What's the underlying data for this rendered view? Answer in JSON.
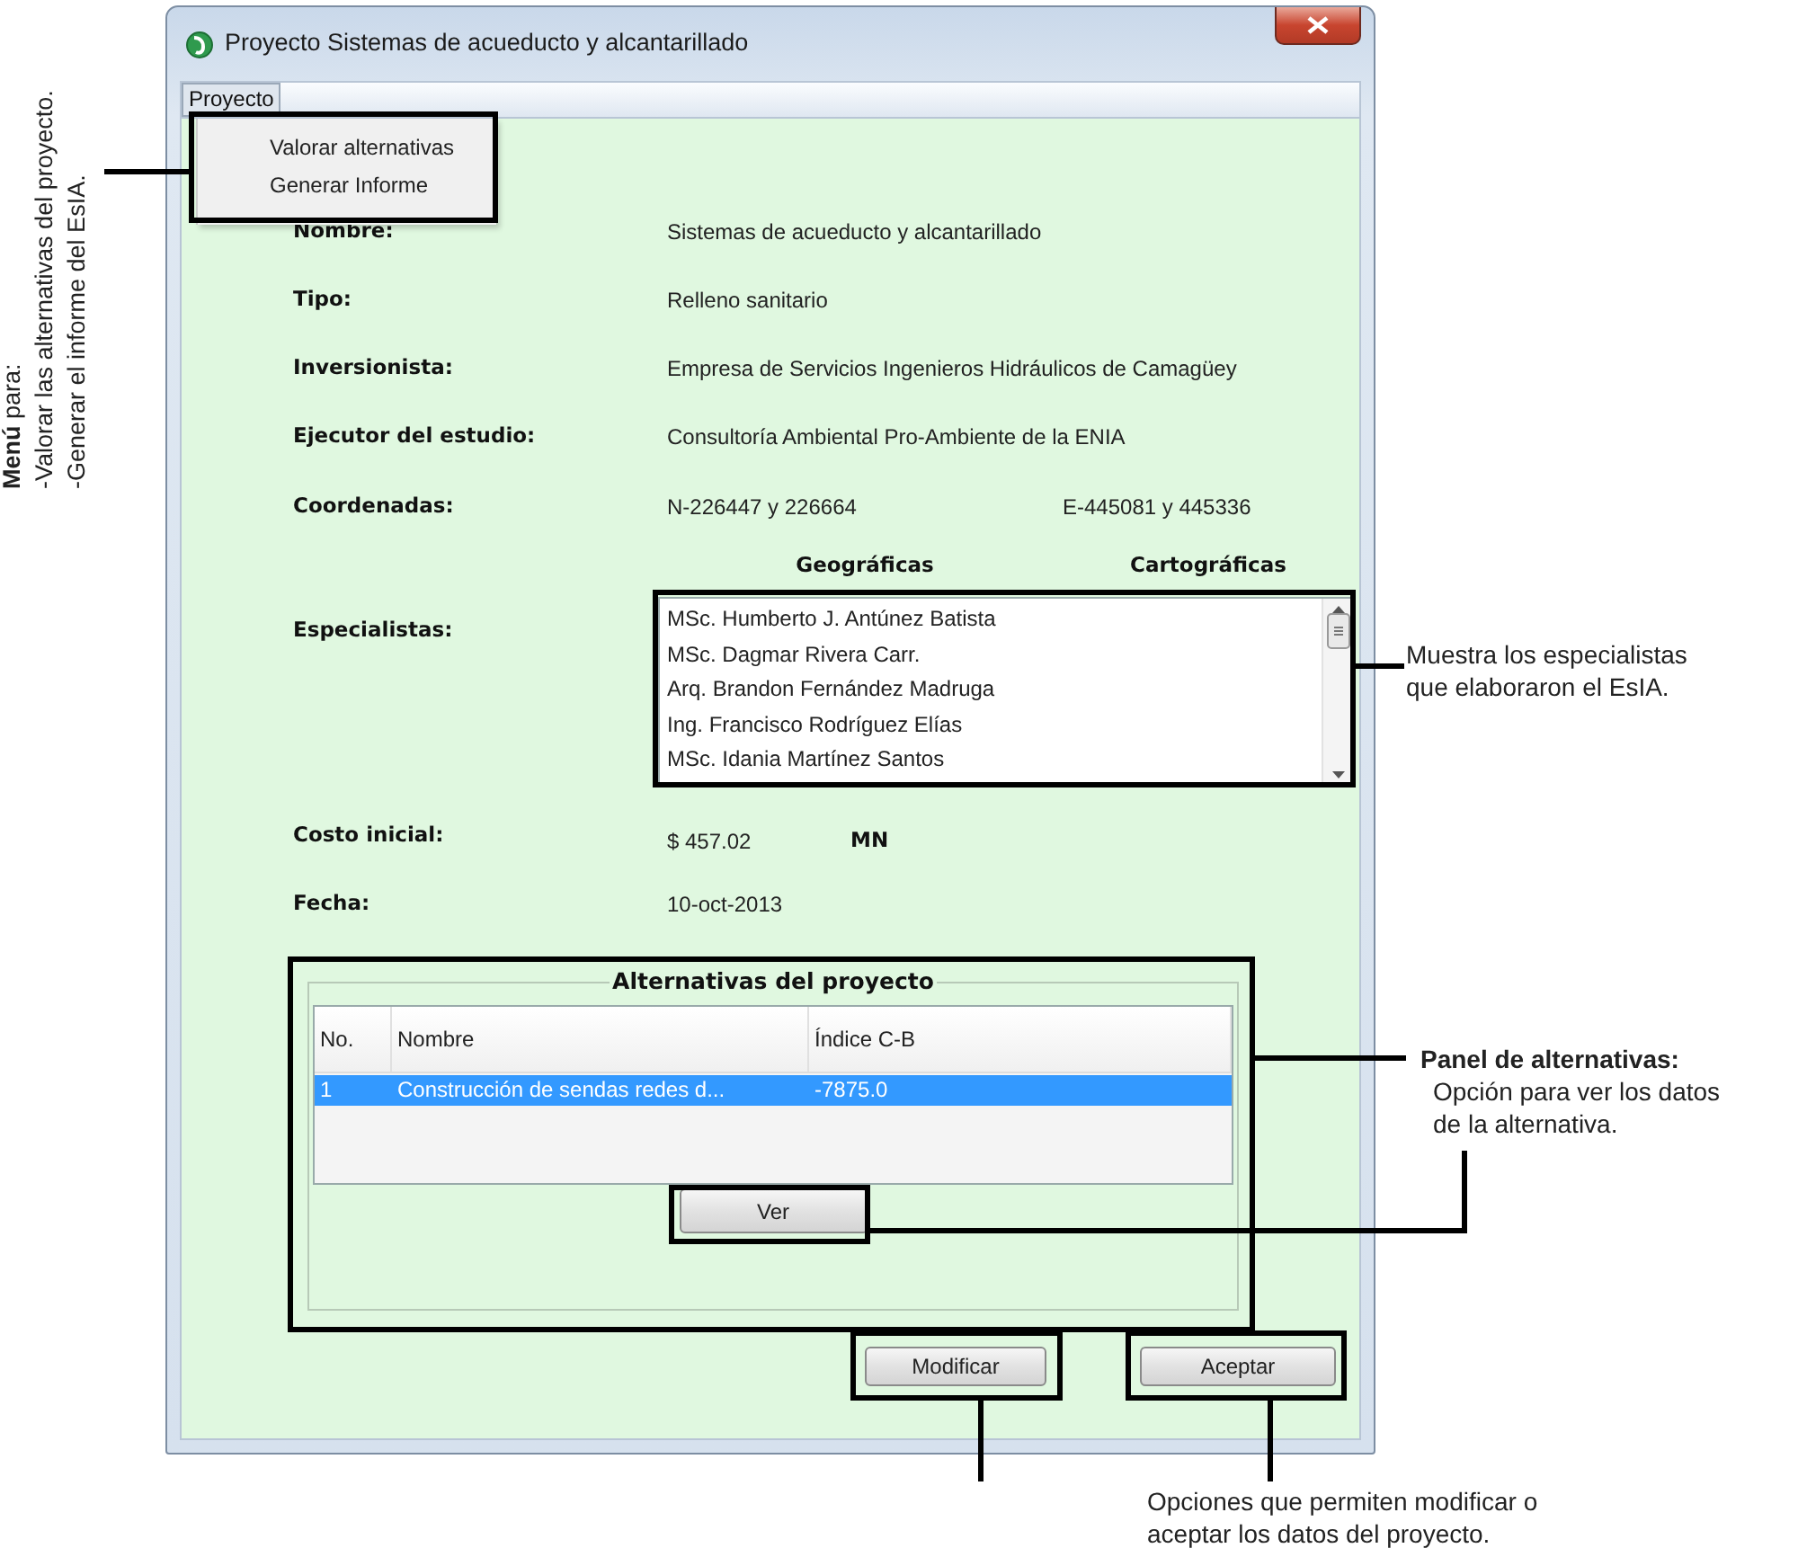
{
  "window": {
    "title": "Proyecto Sistemas de acueducto y alcantarillado"
  },
  "menu_bar": [
    {
      "label": "Proyecto",
      "open": true,
      "items": [
        "Valorar alternativas",
        "Generar Informe"
      ]
    }
  ],
  "fields": [
    {
      "kind": "text",
      "label": "Nombre:",
      "value": "Sistemas de acueducto y alcantarillado"
    },
    {
      "kind": "text",
      "label": "Tipo:",
      "value": "Relleno sanitario"
    },
    {
      "kind": "text",
      "label": "Inversionista:",
      "value": "Empresa de Servicios Ingenieros Hidráulicos de Camagüey"
    },
    {
      "kind": "text",
      "label": "Ejecutor del estudio:",
      "value": "Consultoría Ambiental Pro-Ambiente de la ENIA"
    },
    {
      "kind": "coords",
      "label": "Coordenadas:",
      "values": [
        {
          "value": "N-226447 y 226664",
          "caption": "Geográficas"
        },
        {
          "value": "E-445081 y 445336",
          "caption": "Cartográficas"
        }
      ]
    },
    {
      "kind": "list",
      "label": "Especialistas:",
      "items": [
        "MSc. Humberto J. Antúnez Batista",
        "MSc. Dagmar Rivera Carr.",
        "Arq. Brandon Fernández Madruga",
        "Ing. Francisco Rodríguez Elías",
        "MSc. Idania Martínez Santos"
      ]
    },
    {
      "kind": "money",
      "label": "Costo inicial:",
      "value": "$ 457.02",
      "unit": "MN"
    },
    {
      "kind": "text",
      "label": "Fecha:",
      "value": "10-oct-2013"
    }
  ],
  "alternatives": {
    "title": "Alternativas del proyecto",
    "columns": [
      "No.",
      "Nombre",
      "Índice C-B"
    ],
    "rows": [
      {
        "cells": [
          "1",
          "Construcción de sendas redes d...",
          "-7875.0"
        ],
        "selected": true
      }
    ],
    "button": "Ver"
  },
  "buttons": [
    "Modificar",
    "Aceptar"
  ],
  "annotations": [
    {
      "kind": "menu",
      "lines": [
        "**Menú** para:",
        "-Valorar las alternativas del proyecto.",
        "-Generar el informe del EsIA."
      ]
    },
    {
      "kind": "specialists",
      "lines": [
        "Muestra los especialistas",
        "que elaboraron el EsIA."
      ]
    },
    {
      "kind": "panel",
      "title": "Panel de alternativas:",
      "lines": [
        "Opción para ver los datos",
        "de la alternativa."
      ]
    },
    {
      "kind": "buttons",
      "lines": [
        "Opciones que permiten modificar o",
        "aceptar los datos del proyecto."
      ]
    }
  ]
}
